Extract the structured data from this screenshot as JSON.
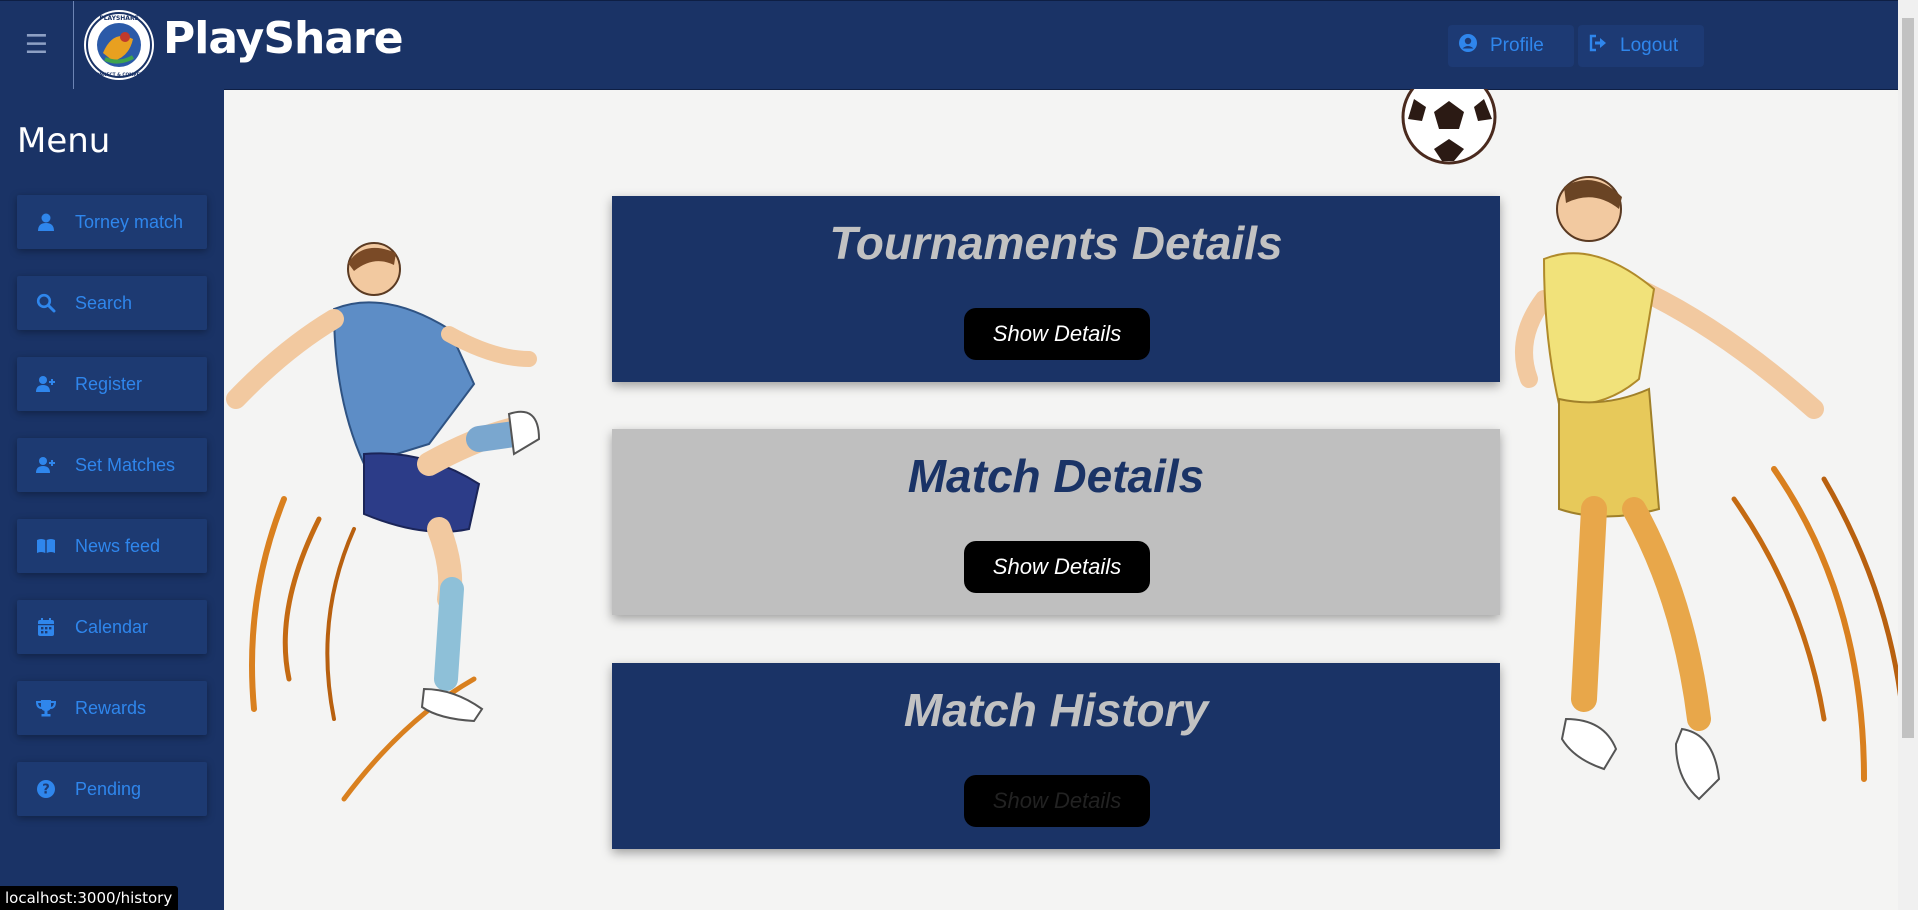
{
  "header": {
    "brand": "PlayShare",
    "logo_text_top": "PLAYSHARE",
    "logo_text_bottom": "CONNECT & COMPETE",
    "menu_icon": "hamburger-icon",
    "profile_label": "Profile",
    "profile_icon": "user-circle-icon",
    "logout_label": "Logout",
    "logout_icon": "sign-out-icon"
  },
  "sidebar": {
    "title": "Menu",
    "items": [
      {
        "label": "Torney match",
        "icon": "user-icon"
      },
      {
        "label": "Search",
        "icon": "search-icon"
      },
      {
        "label": "Register",
        "icon": "user-plus-icon"
      },
      {
        "label": "Set Matches",
        "icon": "user-plus-icon"
      },
      {
        "label": "News feed",
        "icon": "book-open-icon"
      },
      {
        "label": "Calendar",
        "icon": "calendar-icon"
      },
      {
        "label": "Rewards",
        "icon": "trophy-icon"
      },
      {
        "label": "Pending",
        "icon": "question-circle-icon"
      }
    ]
  },
  "cards": [
    {
      "title": "Tournaments Details",
      "button": "Show Details"
    },
    {
      "title": "Match Details",
      "button": "Show Details"
    },
    {
      "title": "Match History",
      "button": "Show Details"
    }
  ],
  "status_bar": {
    "url": "localhost:3000/history"
  },
  "colors": {
    "navy": "#1a3366",
    "accent_blue": "#2f86ec",
    "card_light": "#bfbfbf",
    "background": "#f4f4f3"
  }
}
